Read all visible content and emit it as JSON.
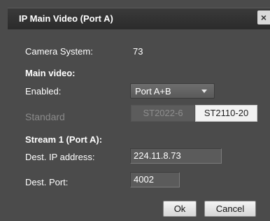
{
  "dialog": {
    "title": "IP Main Video (Port A)",
    "close_glyph": "×"
  },
  "camera_system": {
    "label": "Camera System:",
    "value": "73"
  },
  "main_video": {
    "heading": "Main video:",
    "enabled_label": "Enabled:",
    "enabled_value": "Port A+B",
    "standard_label": "Standard",
    "standard_options": [
      "ST2022-6",
      "ST2110-20"
    ],
    "standard_selected": "ST2110-20"
  },
  "stream1": {
    "heading": "Stream 1 (Port A):",
    "dest_ip_label": "Dest. IP address:",
    "dest_ip_value": "224.11.8.73",
    "dest_port_label": "Dest. Port:",
    "dest_port_value": "4002"
  },
  "buttons": {
    "ok": "Ok",
    "cancel": "Cancel"
  },
  "icons": {
    "close": "close-icon",
    "dropdown": "chevron-down-icon"
  }
}
